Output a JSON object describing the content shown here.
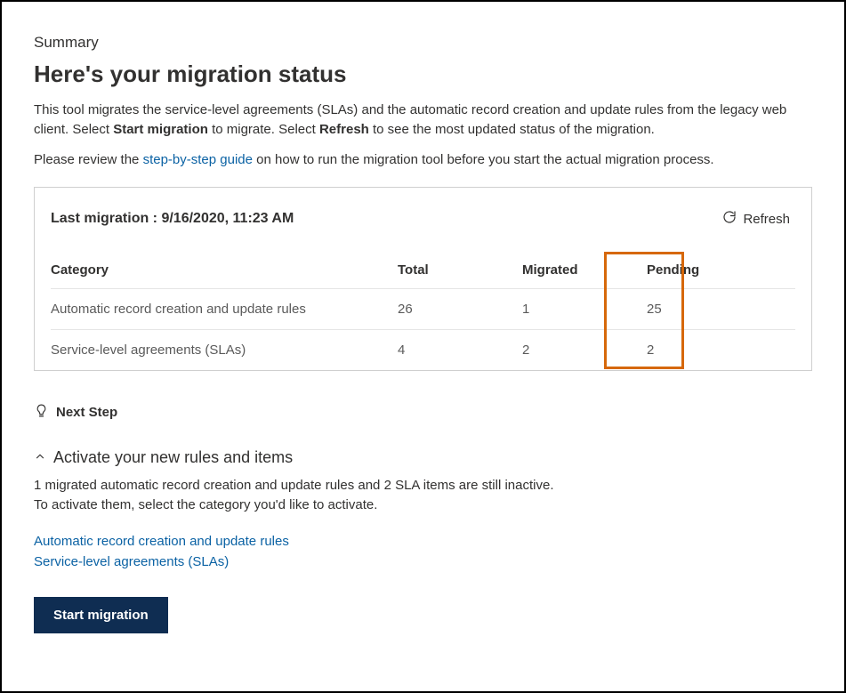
{
  "summary_label": "Summary",
  "page_title": "Here's your migration status",
  "intro_prefix": "This tool migrates the service-level agreements (SLAs) and the automatic record creation and update rules from the legacy web client. Select ",
  "intro_bold1": "Start migration",
  "intro_mid": " to migrate. Select ",
  "intro_bold2": "Refresh",
  "intro_suffix": " to see the most updated status of the migration.",
  "review_prefix": "Please review the ",
  "review_link": "step-by-step guide",
  "review_suffix": " on how to run the migration tool before you start the actual migration process.",
  "card": {
    "last_label": "Last migration : ",
    "last_value": "9/16/2020, 11:23 AM",
    "refresh_label": "Refresh"
  },
  "table": {
    "headers": {
      "category": "Category",
      "total": "Total",
      "migrated": "Migrated",
      "pending": "Pending"
    },
    "rows": [
      {
        "category": "Automatic record creation and update rules",
        "total": "26",
        "migrated": "1",
        "pending": "25"
      },
      {
        "category": "Service-level agreements (SLAs)",
        "total": "4",
        "migrated": "2",
        "pending": "2"
      }
    ]
  },
  "next_step_label": "Next Step",
  "activate": {
    "title": "Activate your new rules and items",
    "line1": "1 migrated automatic record creation and update rules and 2 SLA items are still inactive.",
    "line2": "To activate them, select the category you'd like to activate.",
    "links": [
      "Automatic record creation and update rules",
      "Service-level agreements (SLAs)"
    ]
  },
  "start_button": "Start migration"
}
